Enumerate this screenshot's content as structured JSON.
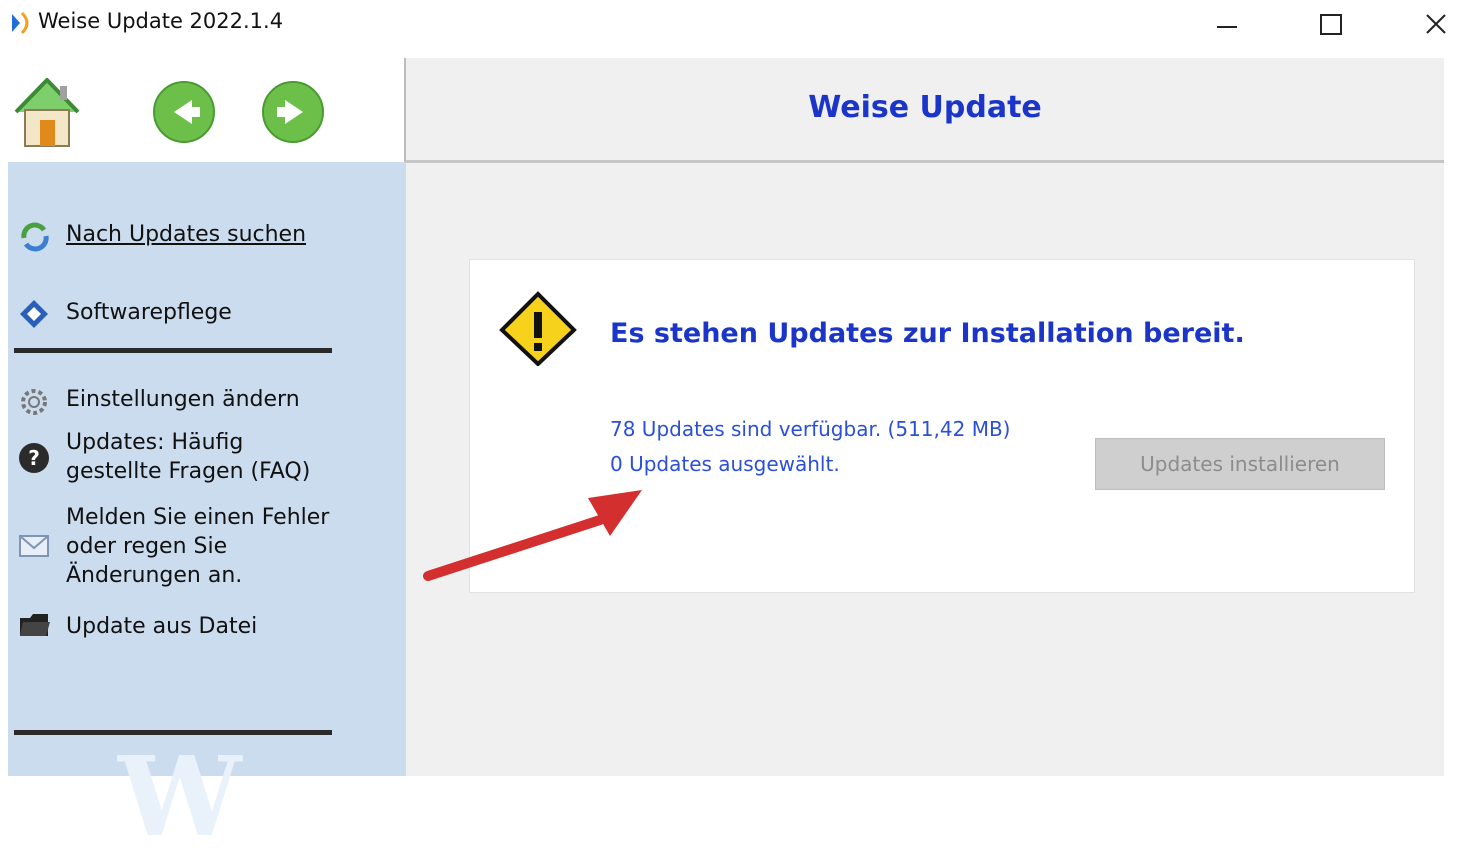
{
  "window": {
    "title": "Weise Update 2022.1.4",
    "controls": {
      "minimize": "—",
      "maximize": "☐",
      "close": "✕"
    }
  },
  "nav": {
    "home_icon": "home-icon",
    "back_icon": "back-arrow-icon",
    "forward_icon": "forward-arrow-icon"
  },
  "sidebar": {
    "items": [
      {
        "label": "Nach Updates suchen",
        "icon": "refresh-icon"
      },
      {
        "label": "Softwarepflege",
        "icon": "diamond-icon"
      },
      {
        "label": "Einstellungen ändern",
        "icon": "gear-icon"
      },
      {
        "label_lines": [
          "Updates: Häufig",
          "gestellte Fragen (FAQ)"
        ],
        "icon": "help-icon"
      },
      {
        "label_lines": [
          "Melden Sie einen Fehler",
          "oder regen Sie",
          "Änderungen an."
        ],
        "icon": "mail-icon"
      },
      {
        "label": "Update aus Datei",
        "icon": "folder-icon"
      }
    ],
    "watermark": "W"
  },
  "header": {
    "title": "Weise Update"
  },
  "card": {
    "heading": "Es stehen Updates zur Installation bereit.",
    "available": "78 Updates sind verfügbar. (511,42 MB)",
    "selected": "0 Updates ausgewählt.",
    "install_button": "Updates installieren",
    "install_enabled": false
  },
  "colors": {
    "accent": "#1a35c8",
    "sidebar": "#cbdcef",
    "arrow": "#d32f2f"
  }
}
